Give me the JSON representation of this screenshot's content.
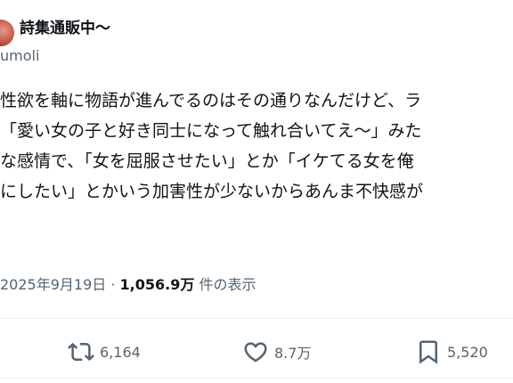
{
  "user": {
    "display_name": "詩集通販中〜",
    "handle": "umoli"
  },
  "tweet": {
    "lines": [
      "性欲を軸に物語が進んでるのはその通りなんだけど、ラ",
      "「愛い女の子と好き同士になって触れ合いてえ〜」みた",
      "な感情で、「女を屈服させたい」とか「イケてる女を俺",
      "にしたい」とかいう加害性が少ないからあんま不快感が"
    ]
  },
  "meta": {
    "date": "2025年9月19日",
    "separator": "·",
    "views_count": "1,056.9万",
    "views_label": "件の表示"
  },
  "actions": {
    "retweet": {
      "icon": "retweet-icon",
      "count": "6,164"
    },
    "like": {
      "icon": "heart-icon",
      "count": "8.7万"
    },
    "bookmark": {
      "icon": "bookmark-icon",
      "count": "5,520"
    }
  },
  "colors": {
    "text": "#0f1419",
    "secondary": "#536471",
    "divider": "#eff3f4"
  }
}
